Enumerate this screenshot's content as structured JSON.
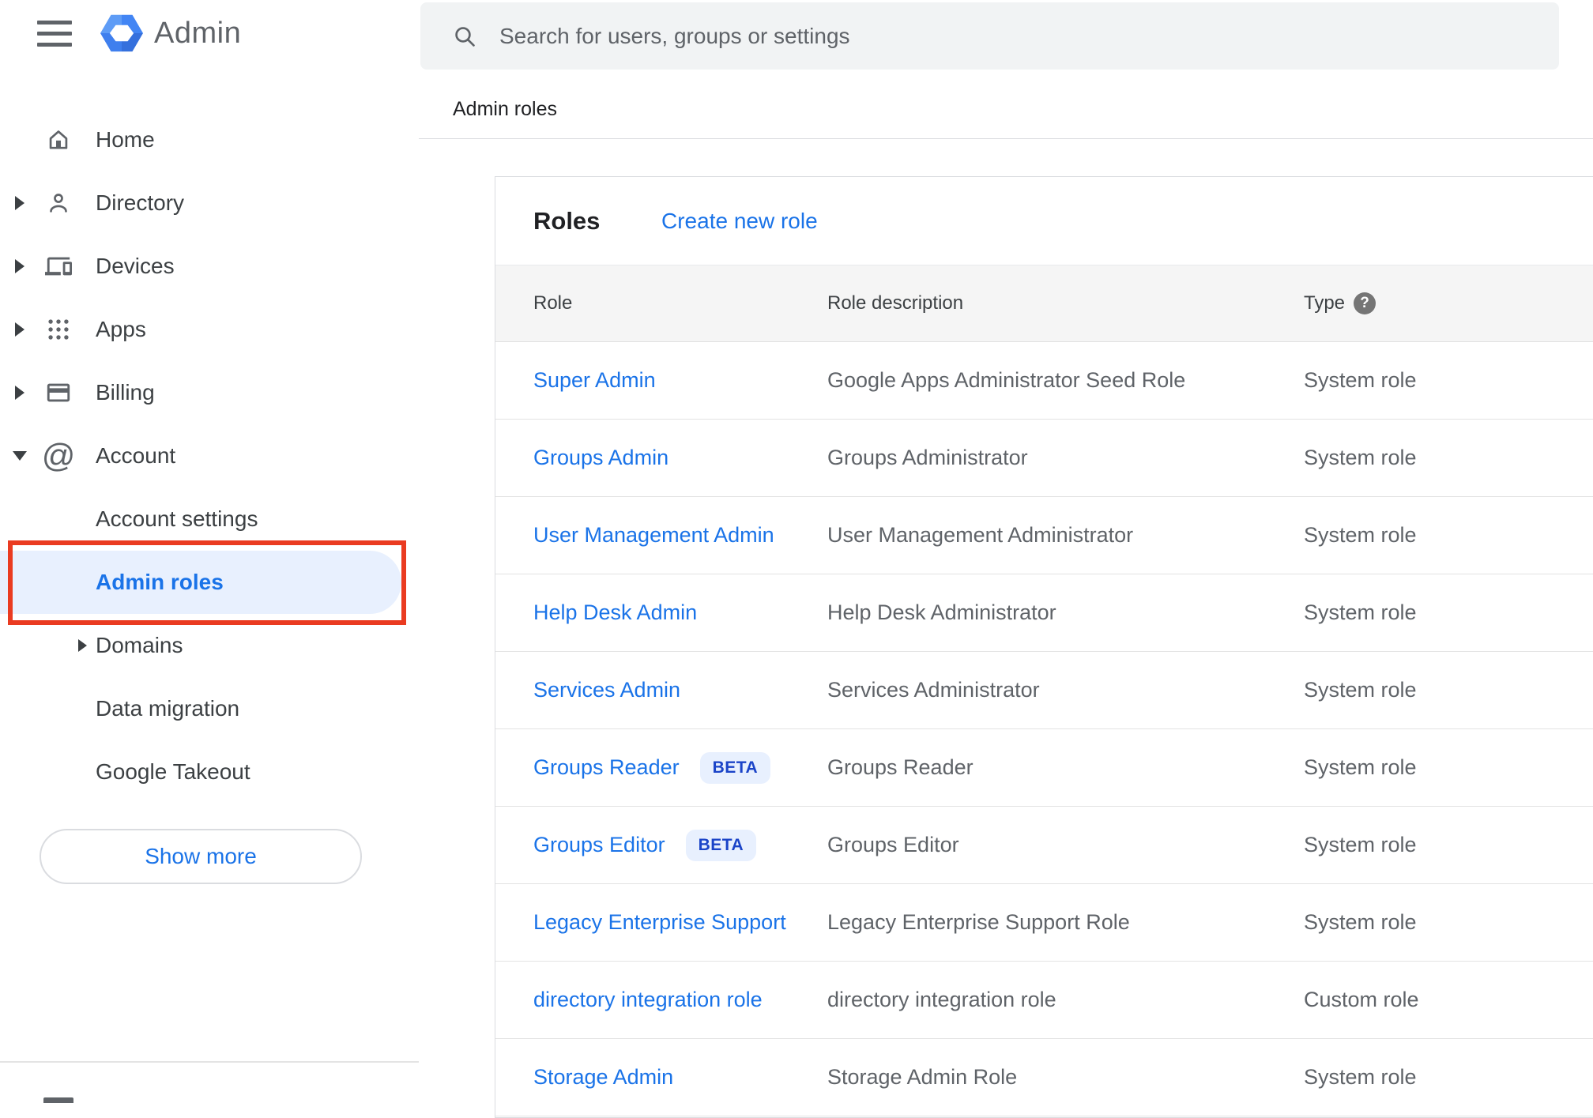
{
  "app": {
    "product_name": "Admin"
  },
  "search": {
    "placeholder": "Search for users, groups or settings"
  },
  "breadcrumb": "Admin roles",
  "sidebar": {
    "items": [
      {
        "label": "Home"
      },
      {
        "label": "Directory"
      },
      {
        "label": "Devices"
      },
      {
        "label": "Apps"
      },
      {
        "label": "Billing"
      },
      {
        "label": "Account"
      },
      {
        "label": "Account settings"
      },
      {
        "label": "Admin roles",
        "selected": true
      },
      {
        "label": "Domains"
      },
      {
        "label": "Data migration"
      },
      {
        "label": "Google Takeout"
      }
    ],
    "show_more_label": "Show more"
  },
  "main": {
    "card_title": "Roles",
    "create_link": "Create new role",
    "table": {
      "columns": [
        "Role",
        "Role description",
        "Type"
      ],
      "beta_label": "BETA",
      "rows": [
        {
          "role": "Super Admin",
          "beta": false,
          "description": "Google Apps Administrator Seed Role",
          "type": "System role"
        },
        {
          "role": "Groups Admin",
          "beta": false,
          "description": "Groups Administrator",
          "type": "System role"
        },
        {
          "role": "User Management Admin",
          "beta": false,
          "description": "User Management Administrator",
          "type": "System role"
        },
        {
          "role": "Help Desk Admin",
          "beta": false,
          "description": "Help Desk Administrator",
          "type": "System role"
        },
        {
          "role": "Services Admin",
          "beta": false,
          "description": "Services Administrator",
          "type": "System role"
        },
        {
          "role": "Groups Reader",
          "beta": true,
          "description": "Groups Reader",
          "type": "System role"
        },
        {
          "role": "Groups Editor",
          "beta": true,
          "description": "Groups Editor",
          "type": "System role"
        },
        {
          "role": "Legacy Enterprise Support",
          "beta": false,
          "description": "Legacy Enterprise Support Role",
          "type": "System role"
        },
        {
          "role": "directory integration role",
          "beta": false,
          "description": "directory integration role",
          "type": "Custom role"
        },
        {
          "role": "Storage Admin",
          "beta": false,
          "description": "Storage Admin Role",
          "type": "System role"
        }
      ]
    }
  },
  "colors": {
    "accent_blue": "#1a73e8",
    "selected_highlight": "#e8f0fe",
    "beta_badge_bg": "#e8f0fe",
    "beta_badge_text": "#1b44c8",
    "annotation_red": "#ea3b21",
    "logo_blue": "#4285f4",
    "table_header_bg": "#f5f5f5",
    "text_gray": "#5f6368"
  }
}
